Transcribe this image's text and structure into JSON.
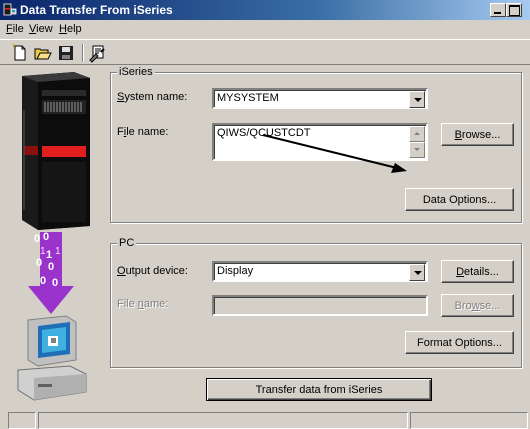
{
  "window": {
    "title": "Data Transfer From iSeries"
  },
  "menu": {
    "file": {
      "mnemonic": "F",
      "rest": "ile"
    },
    "view": {
      "mnemonic": "V",
      "rest": "iew"
    },
    "help": {
      "mnemonic": "H",
      "rest": "elp"
    }
  },
  "toolbar": {
    "icons": [
      "new-document-icon",
      "open-folder-icon",
      "save-disk-icon",
      "properties-icon"
    ]
  },
  "iseries_group": {
    "label": "iSeries",
    "system_name_label": {
      "pre": "",
      "mnemonic": "S",
      "post": "ystem name:"
    },
    "system_name_value": "MYSYSTEM",
    "file_name_label": {
      "pre": "F",
      "mnemonic": "i",
      "post": "le name:"
    },
    "file_name_value": "QIWS/QCUSTCDT",
    "browse_button": {
      "mnemonic": "B",
      "rest": "rowse..."
    },
    "data_options_button": "Data Options..."
  },
  "pc_group": {
    "label": "PC",
    "output_device_label": {
      "pre": "",
      "mnemonic": "O",
      "post": "utput device:"
    },
    "output_device_value": "Display",
    "details_button": {
      "mnemonic": "D",
      "rest": "etails..."
    },
    "file_name_label": {
      "pre": "File ",
      "mnemonic": "n",
      "post": "ame:"
    },
    "file_name_value": "",
    "browse_button": {
      "pre": "Bro",
      "mnemonic": "w",
      "post": "se..."
    },
    "format_options_button": "Format Options..."
  },
  "transfer_button": "Transfer data from iSeries",
  "colors": {
    "titlebar_start": "#0a246a",
    "titlebar_end": "#a6caf0",
    "face": "#d4d0c8",
    "transfer_arrow": "#9933cc"
  }
}
